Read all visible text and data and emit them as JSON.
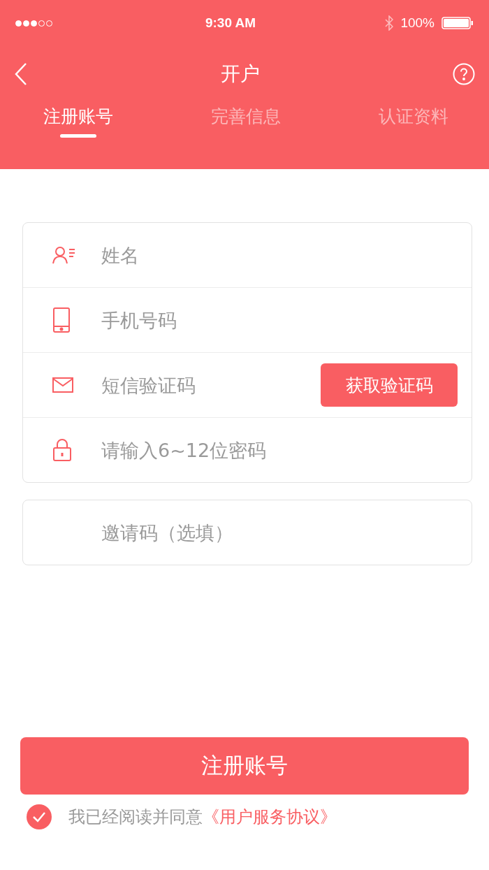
{
  "status_bar": {
    "time": "9:30 AM",
    "battery": "100%"
  },
  "nav": {
    "title": "开户"
  },
  "tabs": [
    {
      "label": "注册账号",
      "selected": true
    },
    {
      "label": "完善信息",
      "selected": false
    },
    {
      "label": "认证资料",
      "selected": false
    }
  ],
  "form": {
    "fields": [
      {
        "kind": "name",
        "placeholder": "姓名"
      },
      {
        "kind": "phone",
        "placeholder": "手机号码"
      },
      {
        "kind": "sms",
        "placeholder": "短信验证码",
        "button": "获取验证码"
      },
      {
        "kind": "password",
        "placeholder": "请输入6~12位密码"
      }
    ]
  },
  "invite": {
    "placeholder": "邀请码（选填）"
  },
  "submit": "注册账号",
  "agreement": {
    "checked": true,
    "text": "我已经阅读并同意",
    "link": "《用户服务协议》"
  }
}
